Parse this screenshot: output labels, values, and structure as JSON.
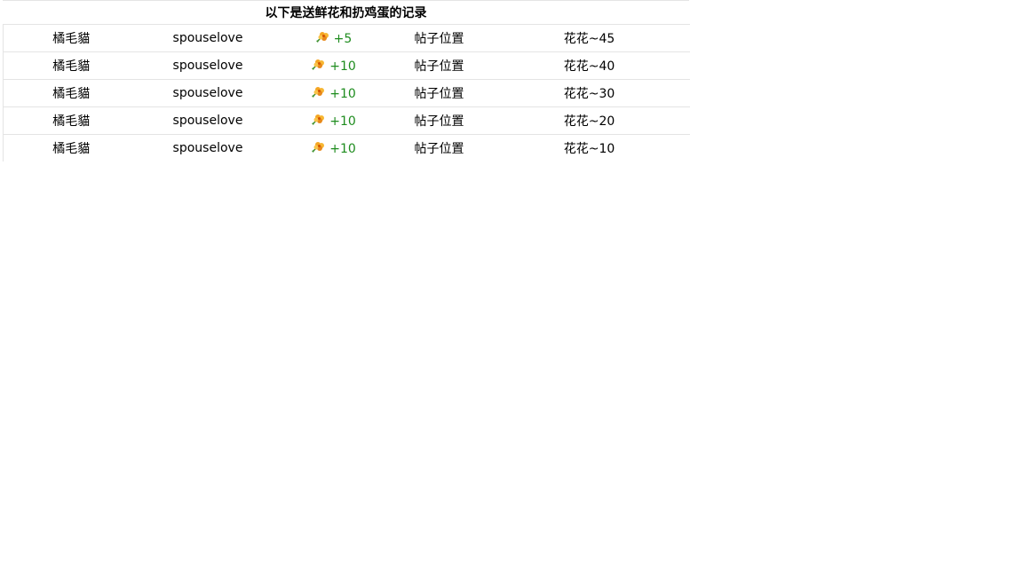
{
  "title": "以下是送鲜花和扔鸡蛋的记录",
  "colors": {
    "flower_value": "#1e8c1e",
    "divider": "#e4e4e4"
  },
  "rows": [
    {
      "user": "橘毛貓",
      "receiver": "spouselove",
      "icon": "flower-icon",
      "amount": "+5",
      "location": "帖子位置",
      "note": "花花~45"
    },
    {
      "user": "橘毛貓",
      "receiver": "spouselove",
      "icon": "flower-icon",
      "amount": "+10",
      "location": "帖子位置",
      "note": "花花~40"
    },
    {
      "user": "橘毛貓",
      "receiver": "spouselove",
      "icon": "flower-icon",
      "amount": "+10",
      "location": "帖子位置",
      "note": "花花~30"
    },
    {
      "user": "橘毛貓",
      "receiver": "spouselove",
      "icon": "flower-icon",
      "amount": "+10",
      "location": "帖子位置",
      "note": "花花~20"
    },
    {
      "user": "橘毛貓",
      "receiver": "spouselove",
      "icon": "flower-icon",
      "amount": "+10",
      "location": "帖子位置",
      "note": "花花~10"
    }
  ]
}
